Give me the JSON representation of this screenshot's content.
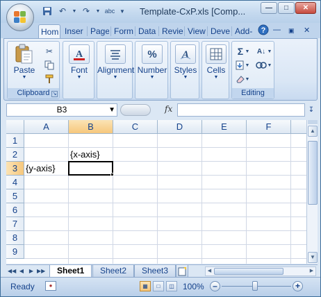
{
  "window": {
    "title": "Template-CxP.xls  [Comp..."
  },
  "quick_access": [
    "save-icon",
    "undo-icon",
    "redo-icon",
    "spelling-icon",
    "customize-icon"
  ],
  "tabs": [
    {
      "label": "Hom",
      "active": true
    },
    {
      "label": "Inser"
    },
    {
      "label": "Page"
    },
    {
      "label": "Form"
    },
    {
      "label": "Data"
    },
    {
      "label": "Revie"
    },
    {
      "label": "View"
    },
    {
      "label": "Deve"
    },
    {
      "label": "Add-"
    }
  ],
  "ribbon": {
    "clipboard": {
      "paste_label": "Paste",
      "group_label": "Clipboard"
    },
    "font": {
      "label": "Font"
    },
    "alignment": {
      "label": "Alignment"
    },
    "number": {
      "label": "Number",
      "icon_text": "%"
    },
    "styles": {
      "label": "Styles"
    },
    "cells": {
      "label": "Cells"
    },
    "editing": {
      "group_label": "Editing"
    }
  },
  "formula_bar": {
    "name_box": "B3",
    "fx_label": "fx",
    "formula": ""
  },
  "grid": {
    "columns": [
      "A",
      "B",
      "C",
      "D",
      "E",
      "F"
    ],
    "rows": [
      "1",
      "2",
      "3",
      "4",
      "5",
      "6",
      "7",
      "8",
      "9"
    ],
    "selected_column": "B",
    "selected_row": "3",
    "cells": {
      "B2": "{x-axis}",
      "A3": "{y-axis}"
    }
  },
  "sheets": [
    {
      "label": "Sheet1",
      "active": true
    },
    {
      "label": "Sheet2"
    },
    {
      "label": "Sheet3"
    }
  ],
  "status": {
    "ready": "Ready",
    "zoom": "100%"
  }
}
